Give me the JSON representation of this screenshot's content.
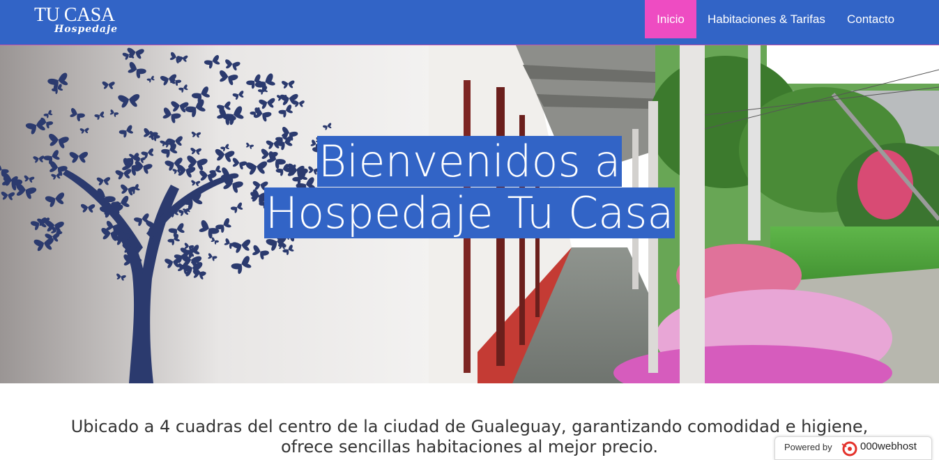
{
  "brand": {
    "name": "TU CASA",
    "tagline": "Hospedaje"
  },
  "nav": {
    "items": [
      {
        "label": "Inicio",
        "active": true
      },
      {
        "label": "Habitaciones & Tarifas",
        "active": false
      },
      {
        "label": "Contacto",
        "active": false
      }
    ]
  },
  "hero": {
    "title_line1": "Bienvenidos a",
    "title_line2": "Hospedaje Tu Casa"
  },
  "intro": {
    "line1": "Ubicado a 4 cuadras del centro de la ciudad de Gualeguay, garantizando comodidad e higiene,",
    "line2": "ofrece sencillas habitaciones al mejor precio."
  },
  "badge": {
    "powered_label": "Powered by",
    "host_name": "000webhost"
  },
  "colors": {
    "navbar": "#3264c6",
    "nav_active": "#ee4cc2",
    "title_highlight": "#3264c6"
  }
}
